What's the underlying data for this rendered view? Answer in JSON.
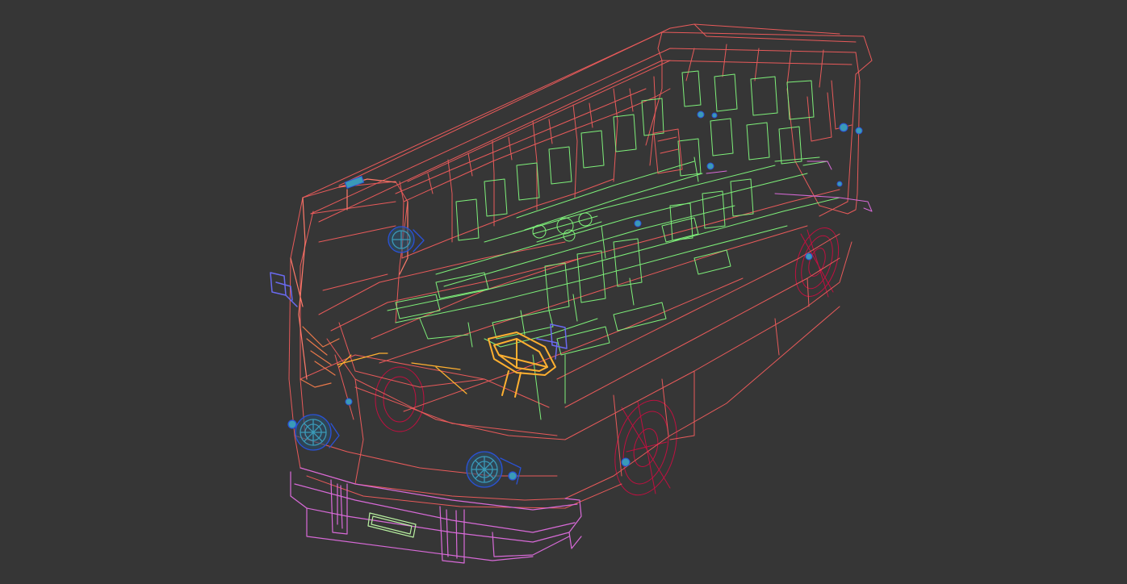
{
  "scene": {
    "subject": "bus-wireframe",
    "background_color": "#363636",
    "colors": {
      "body": "#e85a5a",
      "body_light": "#ff7a6a",
      "front_bumper": "#d86ad8",
      "seats": "#7ef07a",
      "steering": "#ffb030",
      "lights": "#2a52d8",
      "light_glass": "#3a9ab8",
      "wheels": "#c01040",
      "mirrors": "#6a6af0",
      "license_plate": "#b8f0a0"
    },
    "icons": {
      "headlight": "headlight-icon",
      "wheel": "wheel-icon",
      "mirror": "mirror-icon",
      "steering_wheel": "steering-wheel-icon"
    }
  }
}
